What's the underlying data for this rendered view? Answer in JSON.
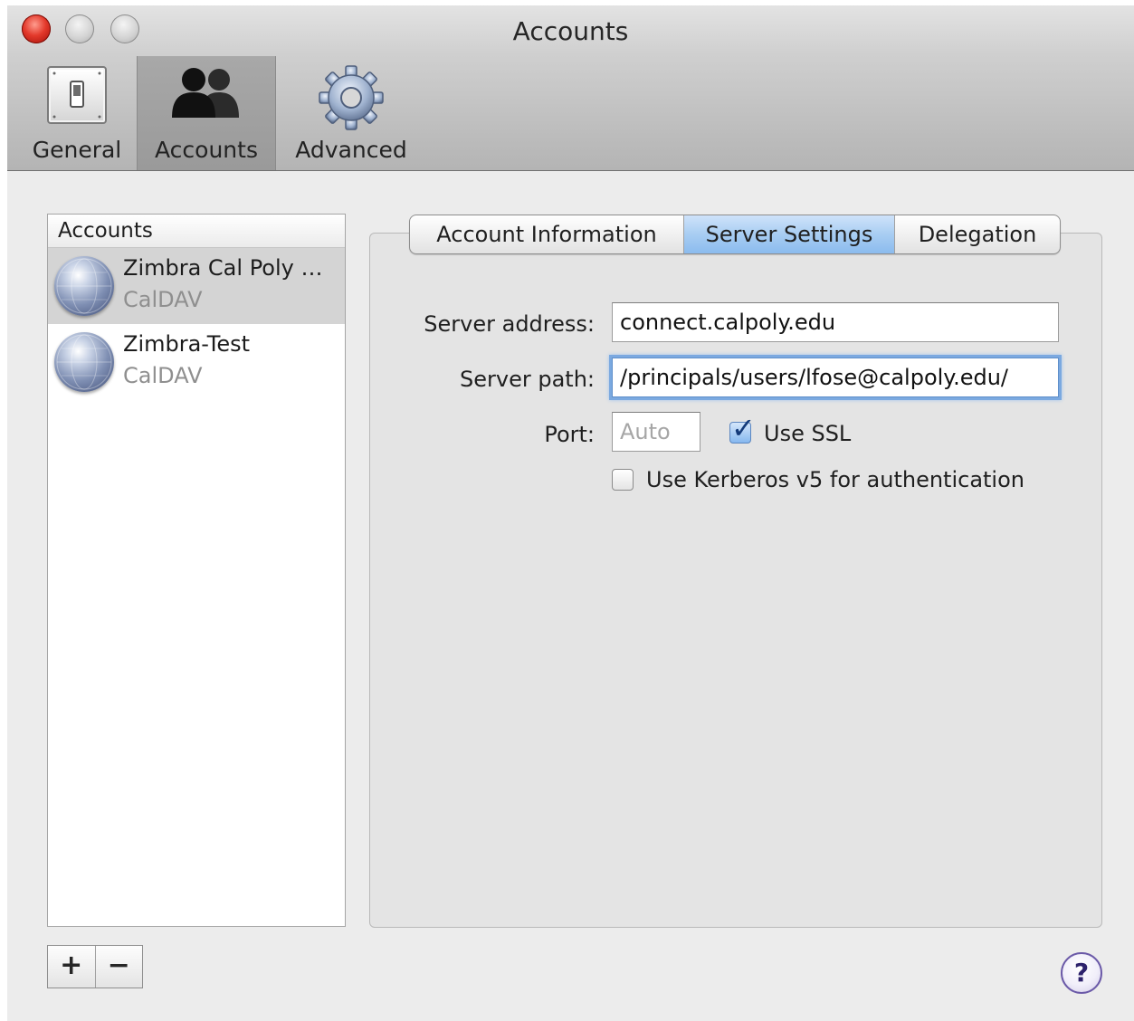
{
  "window": {
    "title": "Accounts"
  },
  "toolbar": {
    "items": [
      {
        "label": "General",
        "icon": "switch-icon",
        "selected": false
      },
      {
        "label": "Accounts",
        "icon": "people-icon",
        "selected": true
      },
      {
        "label": "Advanced",
        "icon": "gear-icon",
        "selected": false
      }
    ]
  },
  "accounts_list": {
    "header": "Accounts",
    "items": [
      {
        "name": "Zimbra Cal Poly …",
        "type": "CalDAV",
        "selected": true,
        "icon": "globe-icon"
      },
      {
        "name": "Zimbra-Test",
        "type": "CalDAV",
        "selected": false,
        "icon": "globe-icon"
      }
    ],
    "add_label": "+",
    "remove_label": "−"
  },
  "tabs": {
    "items": [
      "Account Information",
      "Server Settings",
      "Delegation"
    ],
    "active": "Server Settings"
  },
  "server_settings": {
    "server_address_label": "Server address:",
    "server_address_value": "connect.calpoly.edu",
    "server_path_label": "Server path:",
    "server_path_value": "/principals/users/lfose@calpoly.edu/",
    "port_label": "Port:",
    "port_placeholder": "Auto",
    "use_ssl_label": "Use SSL",
    "use_ssl_checked": true,
    "kerberos_label": "Use Kerberos v5 for authentication",
    "kerberos_checked": false
  },
  "help": {
    "label": "?"
  },
  "colors": {
    "active_tab": "#a8cdf2",
    "selected_row": "#d4d4d4",
    "close_button": "#e3392b",
    "focus_ring": "#7ba9e0"
  }
}
